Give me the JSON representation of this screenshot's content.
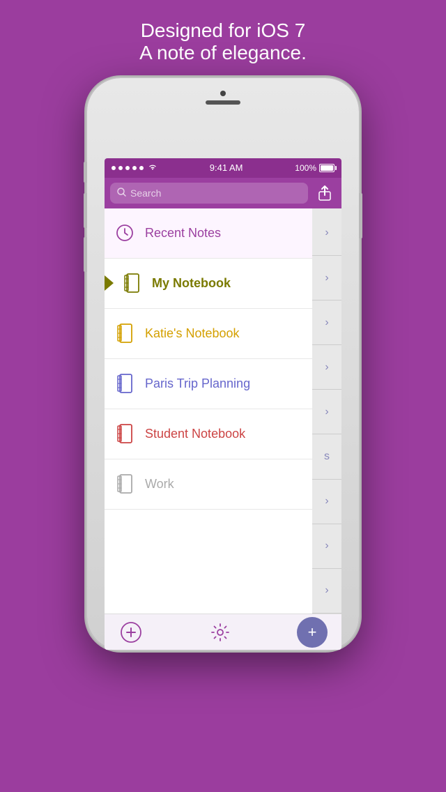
{
  "tagline": {
    "line1": "Designed for iOS 7",
    "line2": "A note of elegance."
  },
  "status_bar": {
    "time": "9:41 AM",
    "battery": "100%",
    "signal_dots": 5
  },
  "toolbar": {
    "search_placeholder": "Search"
  },
  "notebooks": [
    {
      "id": "recent-notes",
      "label": "Recent Notes",
      "icon_type": "clock",
      "color": "#9b3fa0",
      "selected": true,
      "active_arrow": false
    },
    {
      "id": "my-notebook",
      "label": "My Notebook",
      "icon_type": "notebook",
      "color": "#7a7a00",
      "selected": false,
      "active_arrow": true
    },
    {
      "id": "katies-notebook",
      "label": "Katie's Notebook",
      "icon_type": "notebook",
      "color": "#d4a000",
      "selected": false,
      "active_arrow": false
    },
    {
      "id": "paris-trip",
      "label": "Paris Trip Planning",
      "icon_type": "notebook",
      "color": "#6666cc",
      "selected": false,
      "active_arrow": false
    },
    {
      "id": "student-notebook",
      "label": "Student Notebook",
      "icon_type": "notebook",
      "color": "#cc4444",
      "selected": false,
      "active_arrow": false
    },
    {
      "id": "work",
      "label": "Work",
      "icon_type": "notebook",
      "color": "#aaaaaa",
      "selected": false,
      "active_arrow": false
    }
  ],
  "right_sidebar": {
    "chevrons": 8,
    "last_label": "s"
  },
  "bottom_bar": {
    "add_label": "+",
    "settings_label": "⚙",
    "fab_label": "+"
  }
}
